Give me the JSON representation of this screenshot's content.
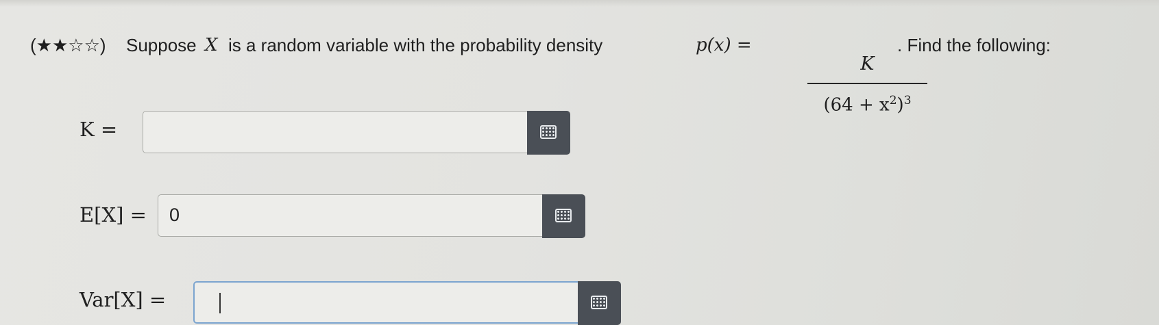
{
  "question": {
    "difficulty_stars": "(★★☆☆)",
    "lead_text": "Suppose",
    "random_variable": "X",
    "mid_text": "is a random variable with the probability density",
    "density_lhs": "p(x) =",
    "fraction_numerator": "K",
    "fraction_denominator_base": "(64 + x",
    "fraction_denominator_inner_exp": "2",
    "fraction_denominator_close": ")",
    "fraction_denominator_exp": "3",
    "trailing_text": ". Find the following:"
  },
  "answers": [
    {
      "label_math": "K =",
      "value": "",
      "focused": false
    },
    {
      "label_math": "E[X] =",
      "value": "0",
      "focused": false
    },
    {
      "label_math": "Var[X] =",
      "value": "",
      "focused": true
    }
  ],
  "icons": {
    "keypad": "calculator-keypad-icon"
  },
  "colors": {
    "keypad_button": "#4a4f56",
    "focus_border": "#7ba4cf",
    "input_background": "#ededea"
  }
}
